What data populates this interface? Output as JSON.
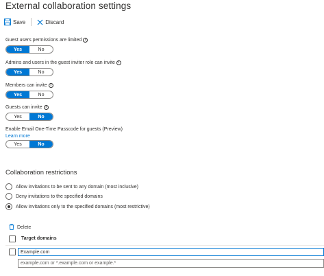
{
  "header": {
    "title": "External collaboration settings"
  },
  "toolbar": {
    "save_label": "Save",
    "discard_label": "Discard"
  },
  "settings": [
    {
      "label": "Guest users permissions are limited",
      "yes": "Yes",
      "no": "No",
      "value": "Yes"
    },
    {
      "label": "Admins and users in the guest inviter role can invite",
      "yes": "Yes",
      "no": "No",
      "value": "Yes"
    },
    {
      "label": "Members can invite",
      "yes": "Yes",
      "no": "No",
      "value": "Yes"
    },
    {
      "label": "Guests can invite",
      "yes": "Yes",
      "no": "No",
      "value": "No"
    },
    {
      "label": "Enable Email One-Time Passcode for guests (Preview)",
      "yes": "Yes",
      "no": "No",
      "value": "No",
      "link": "Learn more"
    }
  ],
  "restrictions": {
    "title": "Collaboration restrictions",
    "options": [
      {
        "label": "Allow invitations to be sent to any domain (most inclusive)",
        "checked": false
      },
      {
        "label": "Deny invitations to the specified domains",
        "checked": false
      },
      {
        "label": "Allow invitations only to the specified domains (most restrictive)",
        "checked": true
      }
    ]
  },
  "domains": {
    "delete_label": "Delete",
    "column_header": "Target domains",
    "entries": [
      "Example.com"
    ],
    "new_placeholder": "example.com or *.example.com or example.*"
  },
  "colors": {
    "accent": "#0078d4",
    "text": "#323130"
  },
  "icons": {
    "save": "save-icon",
    "discard": "discard-x-icon",
    "info": "info-icon",
    "delete": "trash-icon"
  }
}
